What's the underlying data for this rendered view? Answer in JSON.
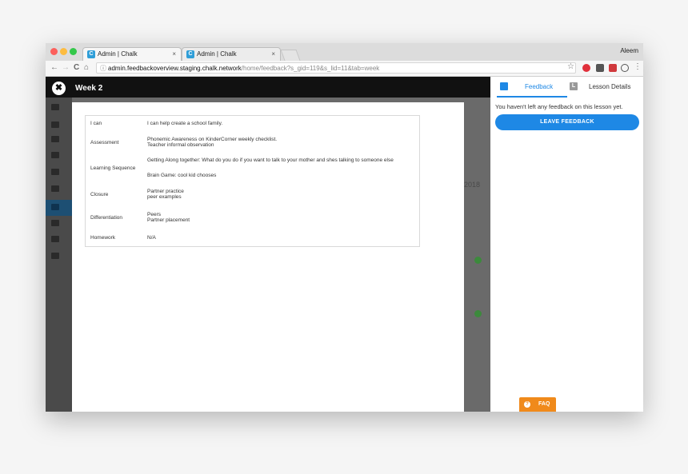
{
  "browser": {
    "tabs": [
      {
        "favicon": "C",
        "title": "Admin | Chalk",
        "close": "×"
      },
      {
        "favicon": "C",
        "title": "Admin | Chalk",
        "close": "×"
      }
    ],
    "profile": "Aleem",
    "nav": {
      "back": "←",
      "forward": "→",
      "reload": "C",
      "home": "⌂"
    },
    "url": {
      "info_icon": "ⓘ",
      "host": "admin.feedbackoverview.staging.chalk.network",
      "path": "/home/feedback?s_gid=119&s_lid=11&tab=week"
    },
    "star": "☆",
    "menu": "⋮"
  },
  "header": {
    "close_icon": "✖",
    "title": "Week 2"
  },
  "lesson": {
    "rows": [
      {
        "label": "I can",
        "values": [
          "I can help create a school family."
        ]
      },
      {
        "label": "Assessment",
        "values": [
          "Phonemic Awareness on KinderCorner weekly checklist.",
          "Teacher informal observation"
        ]
      },
      {
        "label": "Learning Sequence",
        "values": [
          "Getting Along together: What do you do if you want to talk to your mother and shes talking to someone else",
          "Brain Game: cool kid chooses"
        ]
      },
      {
        "label": "Closure",
        "values": [
          "Partner practice",
          "peer examples"
        ]
      },
      {
        "label": "Differentiation",
        "values": [
          "Peers",
          "Partner placement"
        ]
      },
      {
        "label": "Homework",
        "values": [
          "N/A"
        ]
      }
    ]
  },
  "background": {
    "year_fragment": "2018"
  },
  "panel": {
    "tabs": {
      "feedback": "Feedback",
      "lesson_details_icon": "L",
      "lesson_details": "Lesson Details"
    },
    "empty_message": "You haven't left any feedback on this lesson yet.",
    "leave_button": "LEAVE FEEDBACK",
    "faq": "FAQ",
    "faq_icon": "?"
  },
  "colors": {
    "accent": "#1e88e5",
    "faq": "#f08a1b",
    "header": "#111111"
  }
}
